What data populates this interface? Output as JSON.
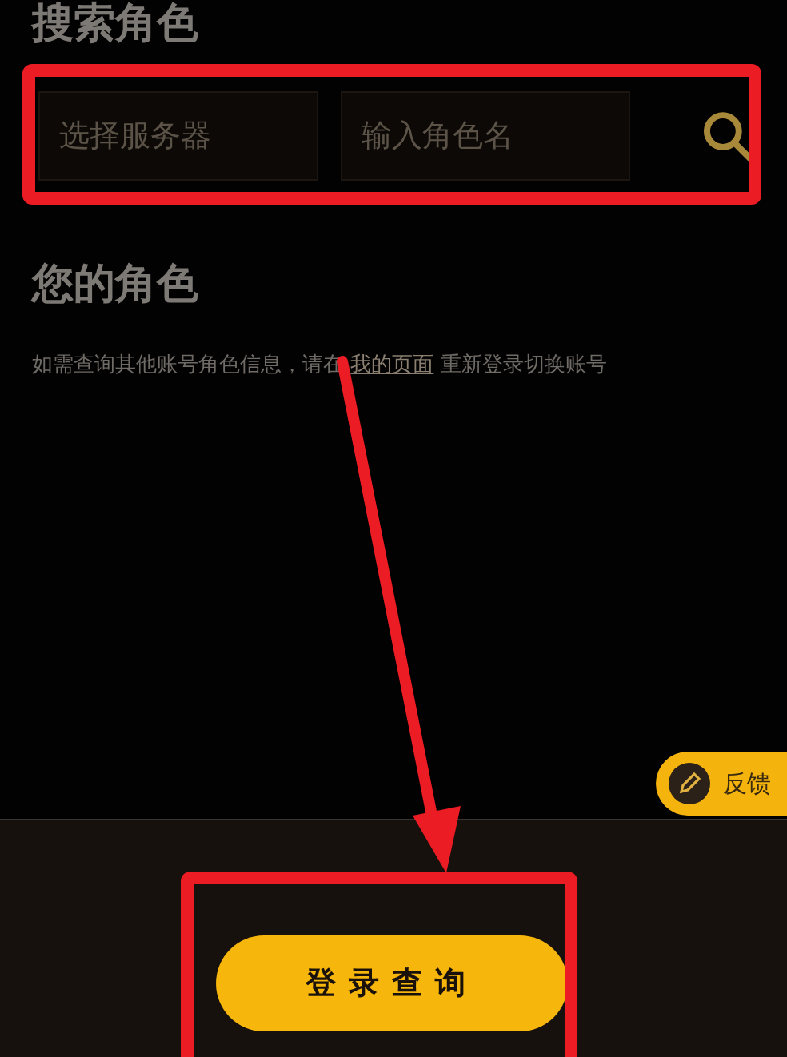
{
  "search_section": {
    "title": "搜索角色",
    "server_field": {
      "placeholder": "选择服务器"
    },
    "name_field": {
      "placeholder": "输入角色名"
    }
  },
  "roles_section": {
    "title": "您的角色",
    "hint": {
      "before": "如需查询其他账号角色信息，请在 ",
      "link": "我的页面",
      "after": " 重新登录切换账号"
    }
  },
  "feedback_button": {
    "label": "反馈"
  },
  "login_button": {
    "label": "登录查询"
  }
}
